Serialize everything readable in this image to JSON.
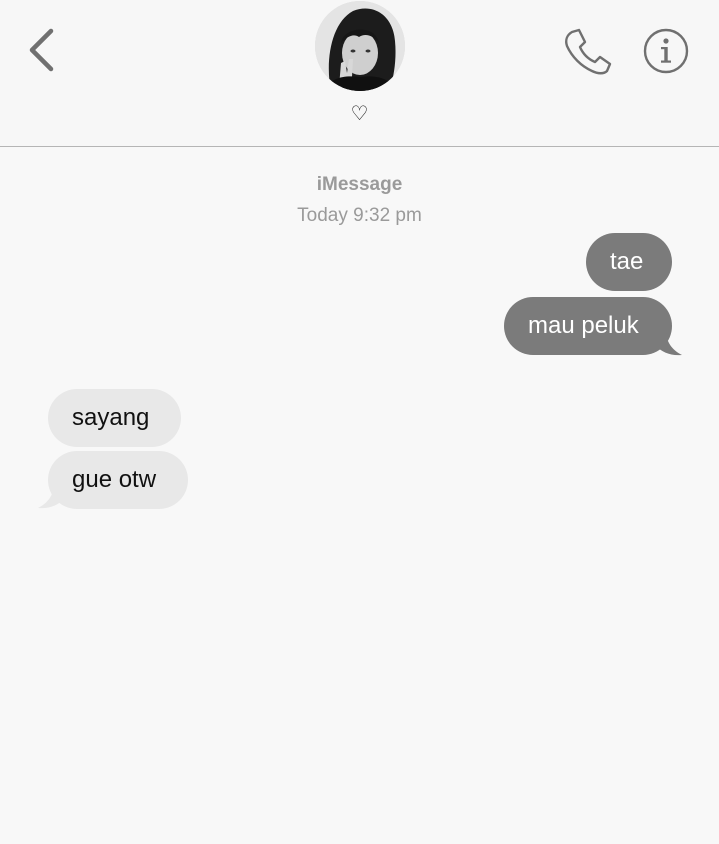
{
  "header": {
    "contact_name": "♡",
    "back_icon": "chevron-left-icon",
    "call_icon": "phone-icon",
    "info_icon": "info-icon"
  },
  "thread": {
    "service": "iMessage",
    "timestamp": "Today 9:32 pm"
  },
  "messages": [
    {
      "direction": "outgoing",
      "text": "tae"
    },
    {
      "direction": "outgoing",
      "text": "mau peluk"
    },
    {
      "direction": "incoming",
      "text": "sayang"
    },
    {
      "direction": "incoming",
      "text": "gue otw"
    }
  ],
  "colors": {
    "background": "#f8f8f8",
    "outgoing_bubble": "#7b7b7b",
    "incoming_bubble": "#e8e8e8",
    "meta_text": "#9a9a9a",
    "icon": "#707070"
  }
}
